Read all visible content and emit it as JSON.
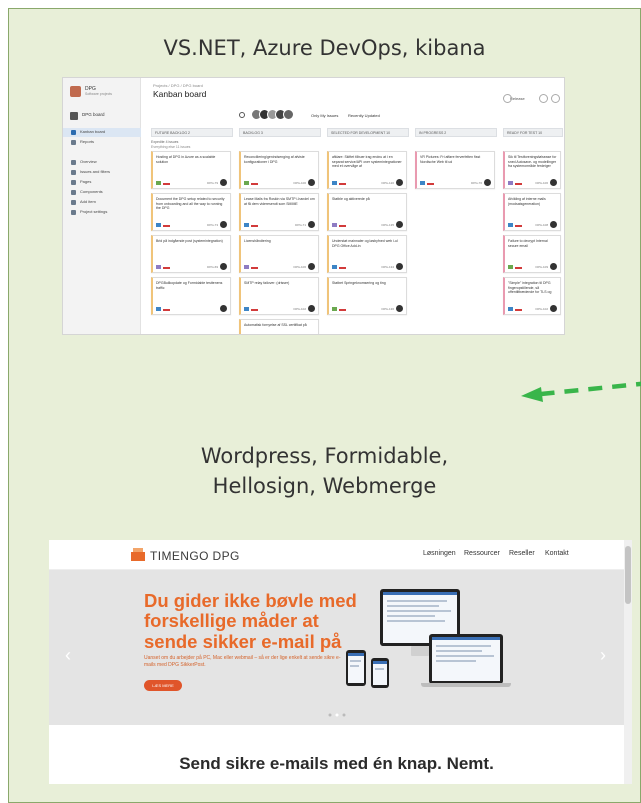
{
  "panel": {
    "caption_top": "VS.NET, Azure DevOps, kibana",
    "caption_bottom_line1": "Wordpress, Formidable,",
    "caption_bottom_line2": "Hellosign, Webmerge"
  },
  "kanban": {
    "org": "DPG",
    "org_sub": "Software projects",
    "project": "DPG board",
    "breadcrumb": "Projects / DPG / DPG board",
    "title": "Kanban board",
    "nav": [
      "Overview",
      "Issues and filters",
      "Pages",
      "Components",
      "Add item",
      "Project settings"
    ],
    "active_nav": "Kanban board",
    "reports": "Reports",
    "filters": [
      "Only My Issues",
      "Recently Updated"
    ],
    "release": "Release",
    "columns": [
      "FUTURE BACKLOG 2",
      "BACKLOG 3",
      "SELECTED FOR DEVELOPMENT 10",
      "IN PROGRESS 2",
      "READY FOR TEST 10"
    ],
    "swimlane": "Expedite  4 issues",
    "swimlane_sub": "Everything else  11 issues",
    "cards": [
      {
        "col": 0,
        "title": "Hosting af DPG in Azure as a scalable solution",
        "id": "DPG-79"
      },
      {
        "col": 0,
        "title": "Document the DPG setup related to security from onboarding and all the way to running the DPG",
        "id": "DPG-73"
      },
      {
        "col": 0,
        "title": "Brid på indgående post (systemintegration)",
        "id": "DPG-69"
      },
      {
        "col": 0,
        "title": "DPGBuilkopdate og Formidable testtenens traffic",
        "id": ""
      },
      {
        "col": 1,
        "title": "Reconciliering/genindsenging af afviste konfigurationer i DPG",
        "id": "DPG-100"
      },
      {
        "col": 1,
        "title": "Lease Mails fra Roskin via SMTP i-handel om at få dem videresendt som SMIME",
        "id": "DPG-71"
      },
      {
        "col": 1,
        "title": "Licenshåndtering",
        "id": "DPG-106"
      },
      {
        "col": 1,
        "title": "SMTP relay failover: (drisser)",
        "id": "DPG-102"
      },
      {
        "col": 1,
        "title": "Automatisk fornyelse af SSL certifikat på",
        "id": ""
      },
      {
        "col": 2,
        "title": "afklare: Skiftet tilbuer irag endnu at i en separat service/API over systemintegrationer med et overvåge af",
        "id": "DPG-120"
      },
      {
        "col": 2,
        "title": "Statble og aktiverede på",
        "id": "DPG-135"
      },
      {
        "col": 2,
        "title": "Understøt mainnaler og løsbyfned web i-ul DPG Office Add-in",
        "id": "DPG-134"
      },
      {
        "col": 2,
        "title": "Statbet Springeknomsering og ting",
        "id": "DPG-136"
      },
      {
        "col": 3,
        "title": "VR Pictures: Fri afføre ferverfelten fisst Nordische Web til ud",
        "id": "DPG-76"
      },
      {
        "col": 4,
        "title": "Sik til Testforeningsfølsease for sned Autosave- og modellinger fra systemområde ferdeiger med lang",
        "id": "DPG-106"
      },
      {
        "col": 4,
        "title": "Afvikling af interne mails (modsatsgeneration)",
        "id": "DPG-108"
      },
      {
        "col": 4,
        "title": "Failure to decrypt Internal secure email",
        "id": "DPG-109"
      },
      {
        "col": 4,
        "title": "\"Simple\" integration til DPG fingeropstillende, så offentlittrædende for TLS og SMS kan sættes i System",
        "id": "DPG-102"
      }
    ]
  },
  "website": {
    "logo": "TIMENGO DPG",
    "nav": [
      "Løsningen",
      "Ressourcer",
      "Reseller",
      "Kontakt"
    ],
    "headline": "Du gider ikke bøvle med forskellige måder at sende sikker e-mail på",
    "subtext": "Uanset om du arbejder på PC, Mac eller webmail – så er der lige enkelt at sende sikre e-mails med DPG SikkerPost.",
    "button": "LÆS MERE",
    "tagline": "Send sikre e-mails med én knap. Nemt.",
    "prev_arrow": "‹",
    "next_arrow": "›"
  },
  "colors": {
    "panel_bg": "#e8efd8",
    "panel_border": "#8aa86b",
    "arrow": "#39b54a",
    "brand_orange": "#e86a2a"
  }
}
